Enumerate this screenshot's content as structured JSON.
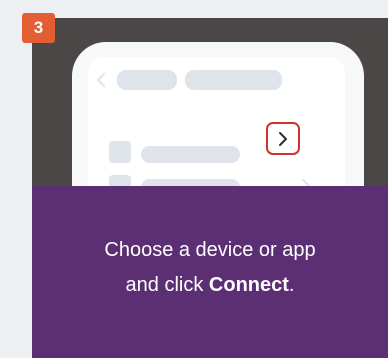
{
  "step": {
    "number": "3"
  },
  "instruction": {
    "line1": "Choose a device or app",
    "line2_prefix": "and click ",
    "line2_bold": "Connect",
    "line2_suffix": "."
  },
  "colors": {
    "page_background": "#edf0f3",
    "card_background": "#4b4746",
    "badge": "#e45e34",
    "panel": "#5c2e73",
    "highlight": "#d3312b"
  },
  "icons": {
    "back": "chevron-left-icon",
    "forward": "chevron-right-icon",
    "connect": "chevron-right-icon"
  }
}
